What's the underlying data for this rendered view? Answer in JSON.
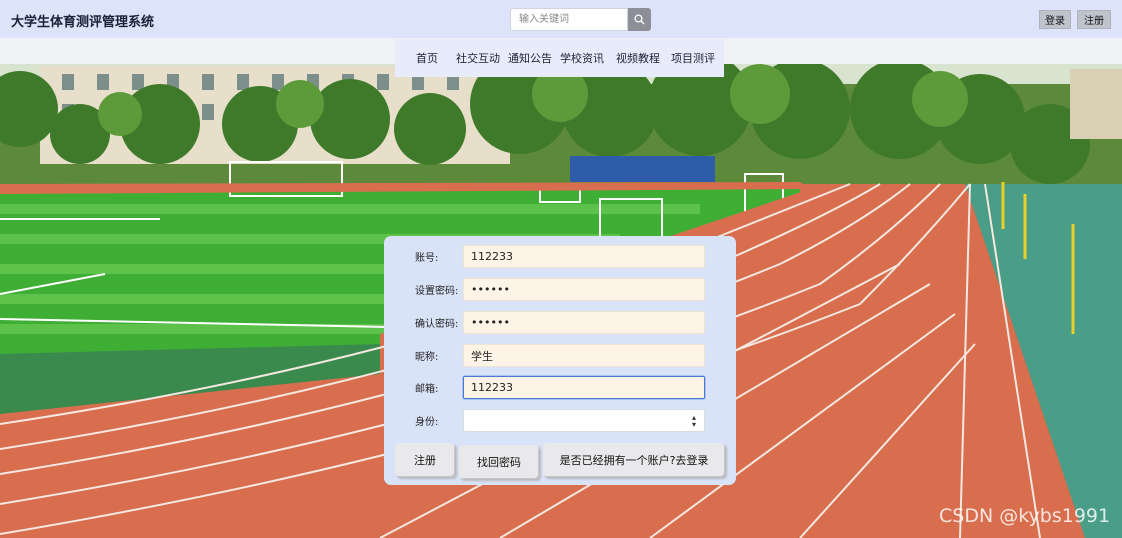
{
  "header": {
    "site_title": "大学生体育测评管理系统",
    "search_placeholder": "输入关键词",
    "login_label": "登录",
    "register_label": "注册"
  },
  "nav": {
    "items": [
      {
        "label": "首页"
      },
      {
        "label": "社交互动"
      },
      {
        "label": "通知公告"
      },
      {
        "label": "学校资讯"
      },
      {
        "label": "视频教程"
      },
      {
        "label": "项目测评"
      }
    ]
  },
  "form": {
    "account": {
      "label": "账号:",
      "value": "112233"
    },
    "password": {
      "label": "设置密码:",
      "value": "••••••"
    },
    "confirm_password": {
      "label": "确认密码:",
      "value": "••••••"
    },
    "nickname": {
      "label": "昵称:",
      "value": "学生"
    },
    "email": {
      "label": "邮箱:",
      "value": "112233"
    },
    "identity": {
      "label": "身份:",
      "value": ""
    },
    "buttons": {
      "register": "注册",
      "recover": "找回密码",
      "to_login": "是否已经拥有一个账户?去登录"
    }
  },
  "colors": {
    "header_bg": "#dce3fa",
    "form_bg": "#d9e3f8",
    "input_bg": "#fdf3e6",
    "track": "#d86e4e",
    "field": "#3fae34"
  },
  "watermark": "CSDN @kybs1991"
}
